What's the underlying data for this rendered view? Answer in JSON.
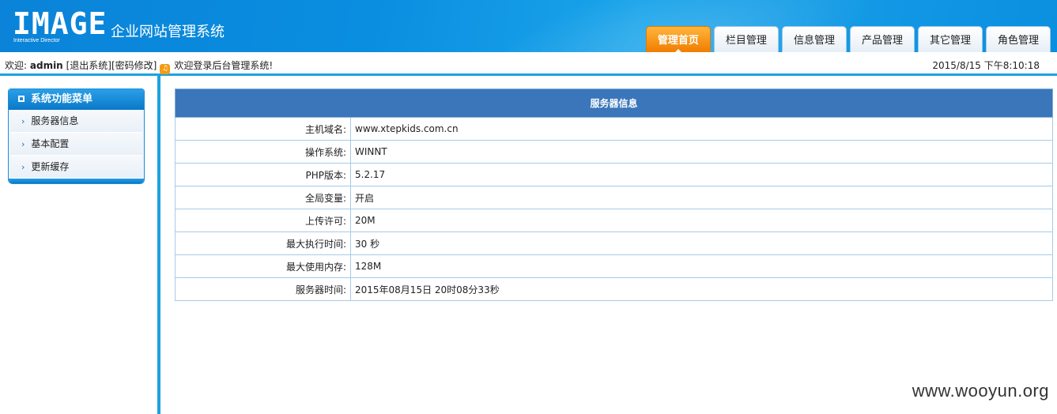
{
  "header": {
    "logo_text": "IMAGE",
    "logo_sub": "Interactive Director",
    "site_title": "企业网站管理系统",
    "tabs": [
      {
        "label": "管理首页",
        "active": true
      },
      {
        "label": "栏目管理"
      },
      {
        "label": "信息管理"
      },
      {
        "label": "产品管理"
      },
      {
        "label": "其它管理"
      },
      {
        "label": "角色管理"
      }
    ]
  },
  "userbar": {
    "welcome_prefix": "欢迎:",
    "username": "admin",
    "logout": "[退出系统]",
    "change_password": "[密码修改]",
    "message": "欢迎登录后台管理系统!",
    "datetime": "2015/8/15 下午8:10:18"
  },
  "sidebar": {
    "title": "系统功能菜单",
    "items": [
      {
        "label": "服务器信息"
      },
      {
        "label": "基本配置"
      },
      {
        "label": "更新缓存"
      }
    ]
  },
  "server_info": {
    "title": "服务器信息",
    "rows": [
      {
        "label": "主机域名:",
        "value": "www.xtepkids.com.cn"
      },
      {
        "label": "操作系统:",
        "value": "WINNT"
      },
      {
        "label": "PHP版本:",
        "value": "5.2.17"
      },
      {
        "label": "全局变量:",
        "value": "开启"
      },
      {
        "label": "上传许可:",
        "value": "20M"
      },
      {
        "label": "最大执行时间:",
        "value": "30 秒"
      },
      {
        "label": "最大使用内存:",
        "value": "128M"
      },
      {
        "label": "服务器时间:",
        "value": "2015年08月15日 20时08分33秒"
      }
    ]
  },
  "watermark": "www.wooyun.org",
  "colors": {
    "header_blue": "#0a8ee0",
    "active_tab_orange": "#f07d00",
    "table_header_blue": "#3a76b9",
    "accent_line": "#1ba3e0"
  }
}
